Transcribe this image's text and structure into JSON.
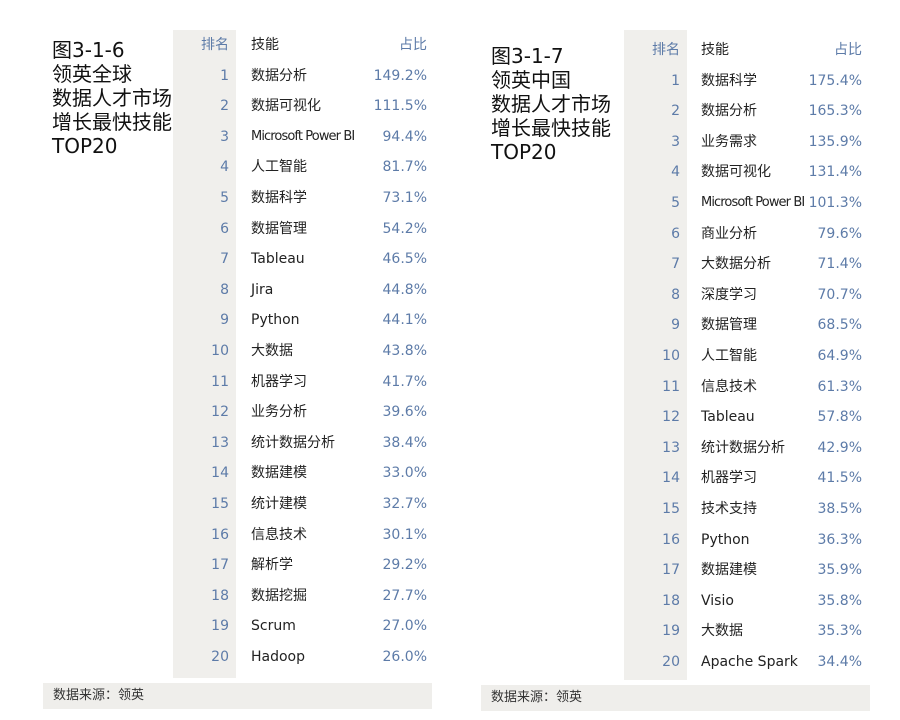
{
  "left": {
    "title_lines": [
      "图3-1-6",
      "领英全球",
      "数据人才市场",
      "增长最快技能",
      "TOP20"
    ],
    "headers": {
      "rank": "排名",
      "skill": "技能",
      "share": "占比"
    },
    "rows": [
      {
        "rank": "1",
        "skill": "数据分析",
        "share": "149.2%"
      },
      {
        "rank": "2",
        "skill": "数据可视化",
        "share": "111.5%"
      },
      {
        "rank": "3",
        "skill": "Microsoft Power BI",
        "share": "94.4%"
      },
      {
        "rank": "4",
        "skill": "人工智能",
        "share": "81.7%"
      },
      {
        "rank": "5",
        "skill": "数据科学",
        "share": "73.1%"
      },
      {
        "rank": "6",
        "skill": "数据管理",
        "share": "54.2%"
      },
      {
        "rank": "7",
        "skill": "Tableau",
        "share": "46.5%"
      },
      {
        "rank": "8",
        "skill": "Jira",
        "share": "44.8%"
      },
      {
        "rank": "9",
        "skill": "Python",
        "share": "44.1%"
      },
      {
        "rank": "10",
        "skill": "大数据",
        "share": "43.8%"
      },
      {
        "rank": "11",
        "skill": "机器学习",
        "share": "41.7%"
      },
      {
        "rank": "12",
        "skill": "业务分析",
        "share": "39.6%"
      },
      {
        "rank": "13",
        "skill": "统计数据分析",
        "share": "38.4%"
      },
      {
        "rank": "14",
        "skill": "数据建模",
        "share": "33.0%"
      },
      {
        "rank": "15",
        "skill": "统计建模",
        "share": "32.7%"
      },
      {
        "rank": "16",
        "skill": "信息技术",
        "share": "30.1%"
      },
      {
        "rank": "17",
        "skill": "解析学",
        "share": "29.2%"
      },
      {
        "rank": "18",
        "skill": "数据挖掘",
        "share": "27.7%"
      },
      {
        "rank": "19",
        "skill": "Scrum",
        "share": "27.0%"
      },
      {
        "rank": "20",
        "skill": "Hadoop",
        "share": "26.0%"
      }
    ],
    "footer": "数据来源：领英"
  },
  "right": {
    "title_lines": [
      "图3-1-7",
      "领英中国",
      "数据人才市场",
      "增长最快技能",
      "TOP20"
    ],
    "headers": {
      "rank": "排名",
      "skill": "技能",
      "share": "占比"
    },
    "rows": [
      {
        "rank": "1",
        "skill": "数据科学",
        "share": "175.4%"
      },
      {
        "rank": "2",
        "skill": "数据分析",
        "share": "165.3%"
      },
      {
        "rank": "3",
        "skill": "业务需求",
        "share": "135.9%"
      },
      {
        "rank": "4",
        "skill": "数据可视化",
        "share": "131.4%"
      },
      {
        "rank": "5",
        "skill": "Microsoft Power BI",
        "share": "101.3%"
      },
      {
        "rank": "6",
        "skill": "商业分析",
        "share": "79.6%"
      },
      {
        "rank": "7",
        "skill": "大数据分析",
        "share": "71.4%"
      },
      {
        "rank": "8",
        "skill": "深度学习",
        "share": "70.7%"
      },
      {
        "rank": "9",
        "skill": "数据管理",
        "share": "68.5%"
      },
      {
        "rank": "10",
        "skill": "人工智能",
        "share": "64.9%"
      },
      {
        "rank": "11",
        "skill": "信息技术",
        "share": "61.3%"
      },
      {
        "rank": "12",
        "skill": "Tableau",
        "share": "57.8%"
      },
      {
        "rank": "13",
        "skill": "统计数据分析",
        "share": "42.9%"
      },
      {
        "rank": "14",
        "skill": "机器学习",
        "share": "41.5%"
      },
      {
        "rank": "15",
        "skill": "技术支持",
        "share": "38.5%"
      },
      {
        "rank": "16",
        "skill": "Python",
        "share": "36.3%"
      },
      {
        "rank": "17",
        "skill": "数据建模",
        "share": "35.9%"
      },
      {
        "rank": "18",
        "skill": "Visio",
        "share": "35.8%"
      },
      {
        "rank": "19",
        "skill": "大数据",
        "share": "35.3%"
      },
      {
        "rank": "20",
        "skill": "Apache Spark",
        "share": "34.4%"
      }
    ],
    "footer": "数据来源：领英"
  }
}
